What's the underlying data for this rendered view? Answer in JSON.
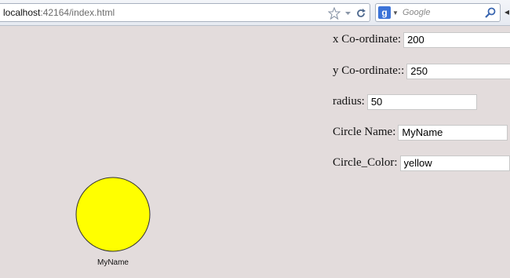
{
  "browser": {
    "url_host": "localhost",
    "url_rest": ":42164/index.html",
    "search_placeholder": "Google",
    "search_engine_icon": "google-g-icon"
  },
  "form": {
    "x": {
      "label": "x Co-ordinate:",
      "value": "200"
    },
    "y": {
      "label": "y Co-ordinate::",
      "value": "250"
    },
    "radius": {
      "label": "radius:",
      "value": "50"
    },
    "name": {
      "label": "Circle Name:",
      "value": "MyName"
    },
    "color": {
      "label": "Circle_Color:",
      "value": "yellow"
    }
  },
  "circle": {
    "fill": "#ffff00",
    "stroke": "#333333",
    "label": "MyName"
  }
}
